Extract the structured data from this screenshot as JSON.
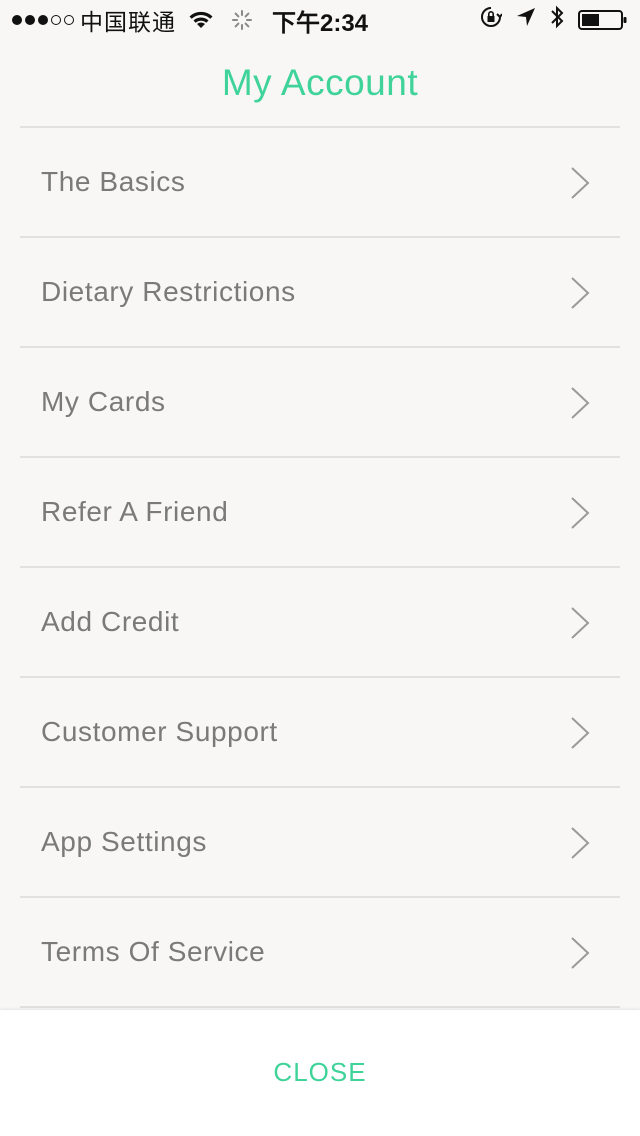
{
  "status_bar": {
    "signal": {
      "filled": 3,
      "total": 5
    },
    "carrier": "中国联通",
    "time": "下午2:34",
    "icons": [
      "wifi-icon",
      "activity-icon",
      "orientation-lock-icon",
      "location-icon",
      "bluetooth-icon",
      "battery-icon"
    ],
    "battery_level": 0.45
  },
  "header": {
    "title": "My Account"
  },
  "menu": {
    "items": [
      {
        "label": "The Basics"
      },
      {
        "label": "Dietary Restrictions"
      },
      {
        "label": "My Cards"
      },
      {
        "label": "Refer A Friend"
      },
      {
        "label": "Add Credit"
      },
      {
        "label": "Customer Support"
      },
      {
        "label": "App Settings"
      },
      {
        "label": "Terms Of Service"
      }
    ]
  },
  "footer": {
    "close_label": "CLOSE"
  },
  "colors": {
    "accent": "#3fd39a",
    "text": "#7a7a7a",
    "divider": "#e2e1df",
    "background": "#f8f7f5"
  }
}
